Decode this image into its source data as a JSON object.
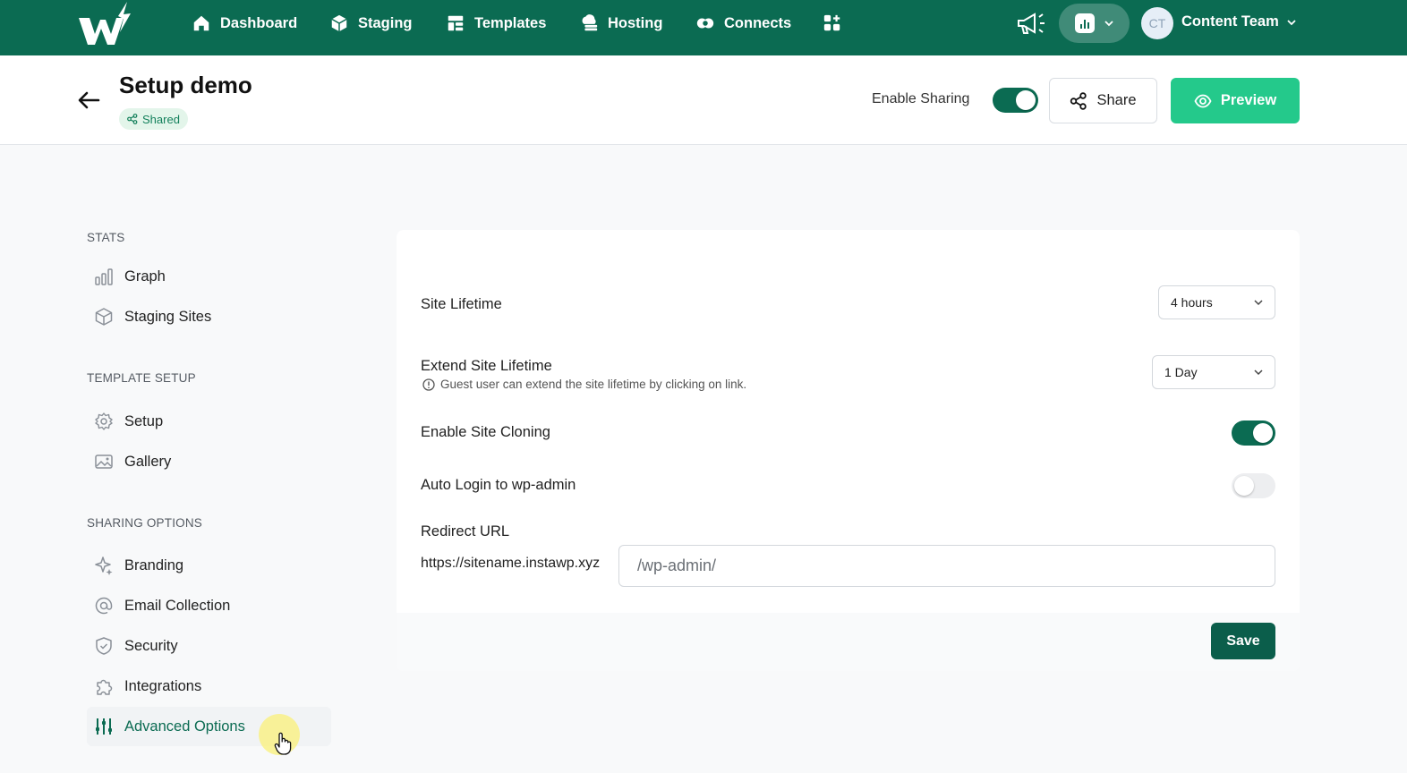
{
  "nav": {
    "items": [
      {
        "label": "Dashboard",
        "icon": "home-icon"
      },
      {
        "label": "Staging",
        "icon": "cube-icon"
      },
      {
        "label": "Templates",
        "icon": "template-icon"
      },
      {
        "label": "Hosting",
        "icon": "cloud-server-icon"
      },
      {
        "label": "Connects",
        "icon": "connects-icon"
      }
    ],
    "apps_icon": "apps-grid-icon",
    "announcements_icon": "megaphone-icon",
    "stats_icon": "bar-chart-icon",
    "user": {
      "initials": "CT",
      "name": "Content Team"
    }
  },
  "header": {
    "title": "Setup demo",
    "badge": "Shared",
    "enable_sharing_label": "Enable Sharing",
    "enable_sharing_on": true,
    "share_label": "Share",
    "preview_label": "Preview"
  },
  "sidebar": {
    "sections": [
      {
        "heading": "STATS",
        "items": [
          {
            "label": "Graph",
            "icon": "bar-chart-icon"
          },
          {
            "label": "Staging Sites",
            "icon": "cube-icon"
          }
        ]
      },
      {
        "heading": "TEMPLATE SETUP",
        "items": [
          {
            "label": "Setup",
            "icon": "gear-icon"
          },
          {
            "label": "Gallery",
            "icon": "image-icon"
          }
        ]
      },
      {
        "heading": "SHARING OPTIONS",
        "items": [
          {
            "label": "Branding",
            "icon": "sparkle-icon"
          },
          {
            "label": "Email Collection",
            "icon": "at-sign-icon"
          },
          {
            "label": "Security",
            "icon": "shield-icon"
          },
          {
            "label": "Integrations",
            "icon": "puzzle-icon"
          },
          {
            "label": "Advanced Options",
            "icon": "sliders-icon",
            "active": true
          }
        ]
      }
    ]
  },
  "settings": {
    "site_lifetime": {
      "label": "Site Lifetime",
      "value": "4 hours"
    },
    "extend_lifetime": {
      "label": "Extend Site Lifetime",
      "value": "1 Day",
      "hint": "Guest user can extend the site lifetime by clicking on link."
    },
    "site_cloning": {
      "label": "Enable Site Cloning",
      "enabled": true
    },
    "auto_login": {
      "label": "Auto Login to wp-admin",
      "enabled": false
    },
    "redirect_url": {
      "label": "Redirect URL",
      "prefix": "https://sitename.instawp.xyz",
      "placeholder": "/wp-admin/"
    },
    "save_label": "Save"
  },
  "colors": {
    "brand_dark": "#0b6b52",
    "preview_green": "#24c98b",
    "save_green": "#0b5e4b"
  }
}
